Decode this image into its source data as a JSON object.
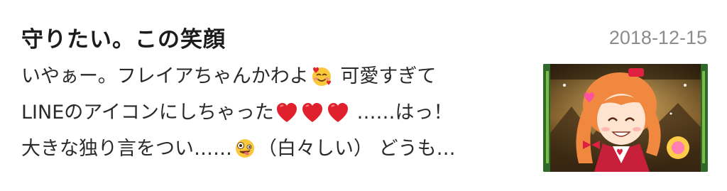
{
  "entry": {
    "title": "守りたい。この笑顔",
    "date": "2018-12-15",
    "excerpt_lines": [
      {
        "text_a": "いやぁー。フレイアちゃんかわよ",
        "text_b": " 可愛すぎて"
      },
      {
        "text_a": "LINEのアイコンにしちゃった",
        "text_b": " ……はっ！"
      },
      {
        "text_a": "大きな独り言をつい……",
        "text_b": "（白々しい） どうも…"
      }
    ],
    "icons": {
      "line1": "smiling-face-with-hearts-icon",
      "line2": "red-heart-icon",
      "line3": "zany-face-icon"
    },
    "colors": {
      "title": "#1c1c1c",
      "date": "#8c8c8c",
      "text": "#2a2a2a",
      "heart": "#e0202c"
    }
  }
}
